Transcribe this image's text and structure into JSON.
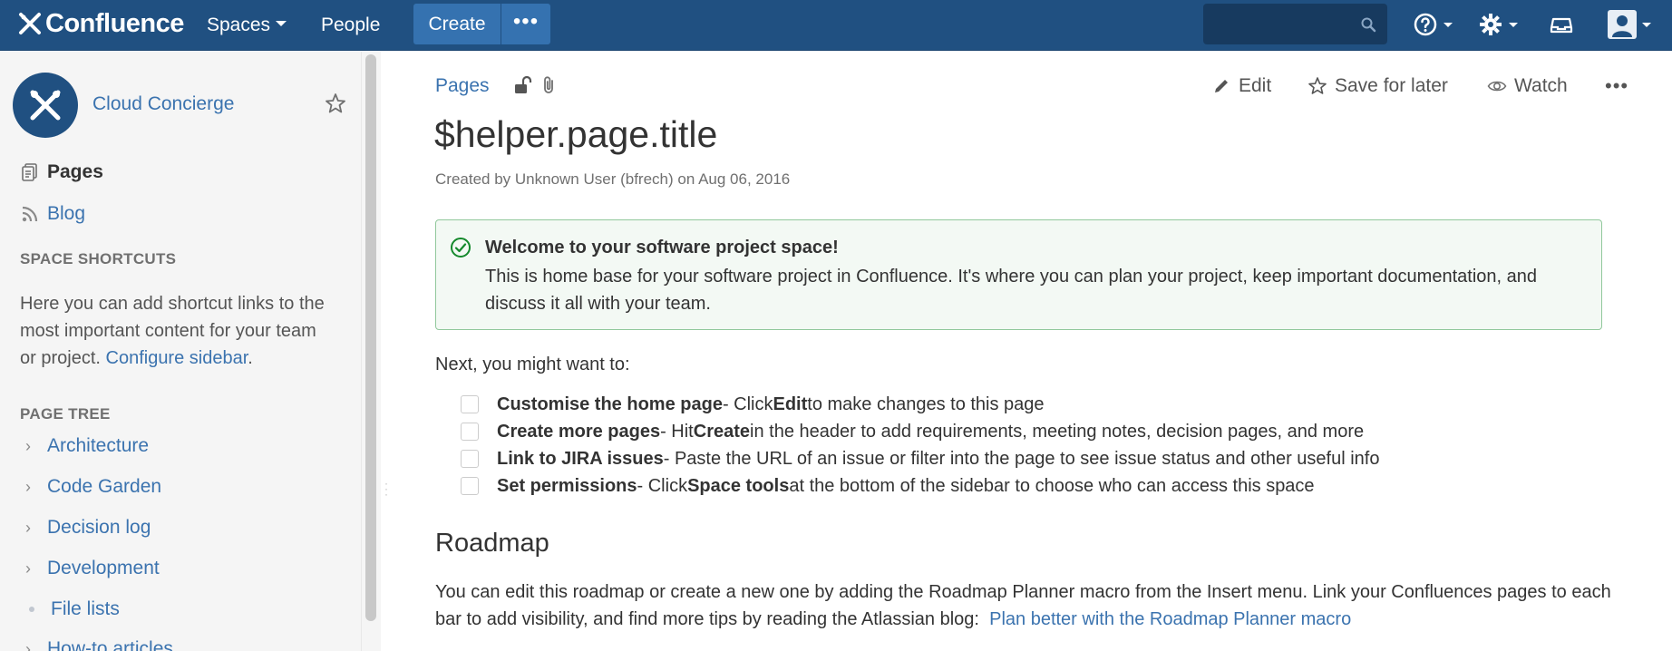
{
  "header": {
    "app_name": "Confluence",
    "nav": [
      {
        "label": "Spaces"
      },
      {
        "label": "People"
      }
    ],
    "create_label": "Create",
    "more_label": "•••",
    "search_placeholder": "",
    "icons": [
      "help-icon",
      "settings-icon",
      "notifications-icon",
      "user-avatar-icon"
    ],
    "colors": {
      "bar": "#205081",
      "button": "#3572b0",
      "search": "#173a5f"
    }
  },
  "sidebar": {
    "space_name": "Cloud Concierge",
    "links": [
      {
        "label": "Pages",
        "icon": "pages-icon"
      },
      {
        "label": "Blog",
        "icon": "rss-icon"
      }
    ],
    "shortcuts_heading": "SPACE SHORTCUTS",
    "shortcuts_text": "Here you can add shortcut links to the most important content for your team or project.",
    "configure_link": "Configure sidebar",
    "configure_suffix": ".",
    "tree_heading": "PAGE TREE",
    "tree": [
      {
        "label": "Architecture",
        "expandable": true
      },
      {
        "label": "Code Garden",
        "expandable": true
      },
      {
        "label": "Decision log",
        "expandable": true
      },
      {
        "label": "Development",
        "expandable": true
      },
      {
        "label": "File lists",
        "expandable": false
      },
      {
        "label": "How-to articles",
        "expandable": true
      }
    ]
  },
  "page": {
    "breadcrumb": "Pages",
    "actions": {
      "edit": "Edit",
      "save_for_later": "Save for later",
      "watch": "Watch",
      "more": "•••"
    },
    "title": "$helper.page.title",
    "byline": "Created by Unknown User (bfrech) on Aug 06, 2016",
    "success": {
      "title": "Welcome to your software project space!",
      "body": "This is home base for your software project in Confluence. It's where you can plan your project, keep important documentation, and discuss it all with your team."
    },
    "next_text": "Next, you might want to:",
    "tasks": [
      {
        "bold": "Customise the home page",
        "sep": " - Click ",
        "bold2": "Edit",
        "rest": " to make changes to this page"
      },
      {
        "bold": "Create more pages",
        "sep": " - Hit ",
        "bold2": "Create",
        "rest": " in the header to add requirements, meeting notes, decision pages, and more"
      },
      {
        "bold": "Link to JIRA issues",
        "sep": " - Paste the URL of an issue or filter into the page to see issue status and other useful info",
        "bold2": "",
        "rest": ""
      },
      {
        "bold": "Set permissions",
        "sep": " - Click ",
        "bold2": "Space tools",
        "rest": " at the bottom of the sidebar to choose who can access this space"
      }
    ],
    "roadmap_heading": "Roadmap",
    "roadmap_text": "You can edit this roadmap or create a new one by adding the Roadmap Planner macro from the Insert menu. Link your Confluences pages to each bar to add visibility, and find more tips by reading the Atlassian blog:",
    "roadmap_link": "Plan better with the Roadmap Planner macro"
  }
}
